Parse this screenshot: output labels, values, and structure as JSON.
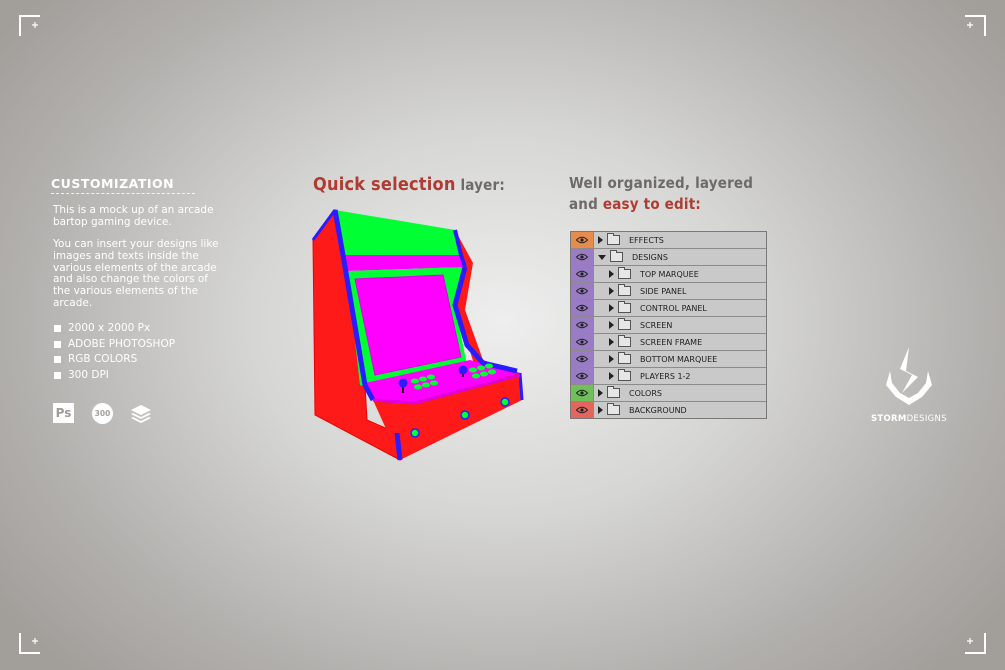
{
  "customization": {
    "title": "CUSTOMIZATION",
    "paragraph1": "This is a mock up of an arcade bartop gaming device.",
    "paragraph2": "You can insert your designs like images and texts inside the various elements of the arcade and also change the colors of the various elements of the arcade.",
    "features": [
      "2000 x 2000 Px",
      "ADOBE PHOTOSHOP",
      "RGB COLORS",
      "300 DPI"
    ],
    "ps_icon_text": "Ps",
    "dpi_icon_text": "300"
  },
  "quick_selection": {
    "highlight": "Quick selection",
    "rest": " layer:"
  },
  "organized": {
    "line1": "Well organized, layered",
    "line2_prefix": "and ",
    "line2_highlight": "easy to edit:"
  },
  "layers": [
    {
      "name": "EFFECTS",
      "color": "#e68c4c",
      "level": 0,
      "expanded": false
    },
    {
      "name": "DESIGNS",
      "color": "#9a7cc4",
      "level": 0,
      "expanded": true
    },
    {
      "name": "TOP MARQUEE",
      "color": "#9a7cc4",
      "level": 1,
      "expanded": false
    },
    {
      "name": "SIDE PANEL",
      "color": "#9a7cc4",
      "level": 1,
      "expanded": false
    },
    {
      "name": "CONTROL PANEL",
      "color": "#9a7cc4",
      "level": 1,
      "expanded": false
    },
    {
      "name": "SCREEN",
      "color": "#9a7cc4",
      "level": 1,
      "expanded": false
    },
    {
      "name": "SCREEN FRAME",
      "color": "#9a7cc4",
      "level": 1,
      "expanded": false
    },
    {
      "name": "BOTTOM MARQUEE",
      "color": "#9a7cc4",
      "level": 1,
      "expanded": false
    },
    {
      "name": "PLAYERS 1-2",
      "color": "#9a7cc4",
      "level": 1,
      "expanded": false
    },
    {
      "name": "COLORS",
      "color": "#6fbf5a",
      "level": 0,
      "expanded": false
    },
    {
      "name": "BACKGROUND",
      "color": "#e0665e",
      "level": 0,
      "expanded": false
    }
  ],
  "logo": {
    "bold": "STORM",
    "light": "DESIGNS"
  },
  "arcade_colors": {
    "body": "#ff1a1a",
    "marquee": "#00ff33",
    "screen": "#ff00ff",
    "trim": "#2a1cff"
  }
}
